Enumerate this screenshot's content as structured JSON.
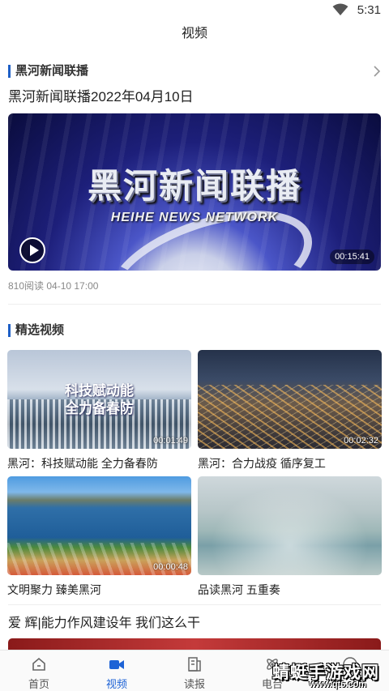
{
  "status": {
    "time": "5:31"
  },
  "header": {
    "title": "视频"
  },
  "section1": {
    "label": "黑河新闻联播"
  },
  "featured": {
    "title": "黑河新闻联播2022年04月10日",
    "overlay_cn": "黑河新闻联播",
    "overlay_en": "HEIHE NEWS NETWORK",
    "duration": "00:15:41",
    "meta": "810阅读  04-10 17:00"
  },
  "section2": {
    "label": "精选视频"
  },
  "videos": [
    {
      "title": "黑河：科技赋动能 全力备春防",
      "duration": "00:01:49",
      "overlay_line1": "科技赋动能",
      "overlay_line2": "全力备春防"
    },
    {
      "title": "黑河：合力战疫 循序复工",
      "duration": "00:02:32"
    },
    {
      "title": "文明聚力  臻美黑河",
      "duration": "00:00:48"
    },
    {
      "title": "品读黑河 五重奏",
      "duration": ""
    }
  ],
  "article": {
    "title": "爱  辉|能力作风建设年  我们这么干"
  },
  "tabs": [
    {
      "label": "首页",
      "icon": "home-icon"
    },
    {
      "label": "视频",
      "icon": "video-camera-icon"
    },
    {
      "label": "读报",
      "icon": "newspaper-icon"
    },
    {
      "label": "电台",
      "icon": "radio-icon"
    },
    {
      "label": "",
      "icon": "user-icon"
    }
  ],
  "active_tab": "视频",
  "watermark": {
    "text": "蜻蜓手游戏网",
    "url": "www.qt6.com"
  },
  "colors": {
    "accent": "#1e63d6",
    "section_bar": "#1e5fc6"
  }
}
